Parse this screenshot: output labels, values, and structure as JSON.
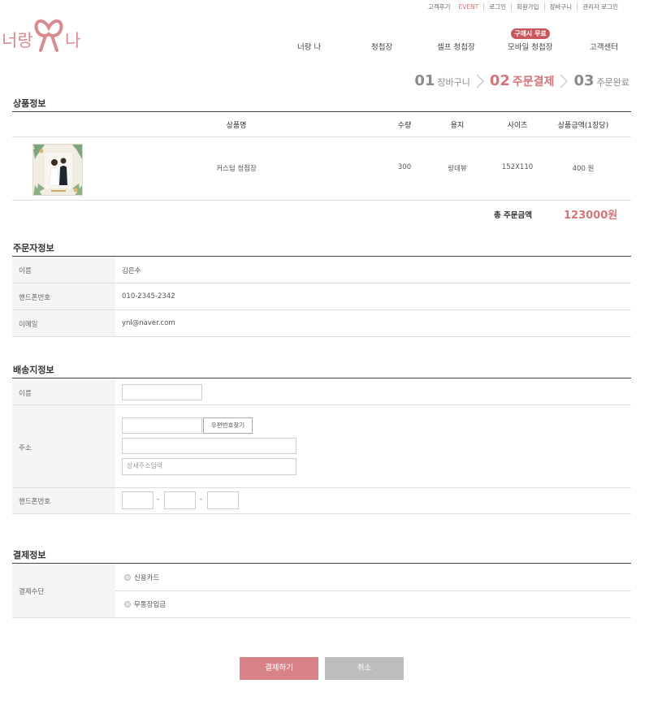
{
  "util_links": [
    "고객후기",
    "EVENT",
    "로그인",
    "회원가입",
    "장바구니",
    "관리자 로그인"
  ],
  "logo": {
    "left": "너랑",
    "right": "나"
  },
  "nav": {
    "items": [
      "너랑 나",
      "청첩장",
      "셀프 청첩장",
      "모바일 청첩장",
      "고객센터"
    ],
    "badge": "구매시 무료"
  },
  "steps": [
    {
      "num": "01",
      "label": "장바구니"
    },
    {
      "num": "02",
      "label": "주문결제"
    },
    {
      "num": "03",
      "label": "주문완료"
    }
  ],
  "product": {
    "title": "상품정보",
    "headers": [
      "상품명",
      "수량",
      "용지",
      "사이즈",
      "상품금액(1장당)"
    ],
    "row": {
      "name": "커스텀 청첩장",
      "qty": "300",
      "paper": "랑데뷰",
      "size": "152X110",
      "price": "400 원"
    },
    "total_label": "총 주문금액",
    "total_value": "123000원"
  },
  "orderer": {
    "title": "주문자정보",
    "rows": [
      {
        "label": "이름",
        "value": "김은수"
      },
      {
        "label": "핸드폰번호",
        "value": "010-2345-2342"
      },
      {
        "label": "이메일",
        "value": "ynl@naver.com"
      }
    ]
  },
  "shipping": {
    "title": "배송지정보",
    "name_label": "이름",
    "address_label": "주소",
    "zip_button": "우편번호찾기",
    "detail_placeholder": "상세주소입력",
    "phone_label": "핸드폰번호",
    "dash": "-"
  },
  "payment": {
    "title": "결제정보",
    "method_label": "결제수단",
    "options": [
      "신용카드",
      "무통장입금"
    ]
  },
  "buttons": {
    "pay": "결제하기",
    "cancel": "취소"
  },
  "colors": {
    "accent": "#d4757a",
    "pay_button": "#d98287",
    "cancel_button": "#bdbdbd"
  }
}
